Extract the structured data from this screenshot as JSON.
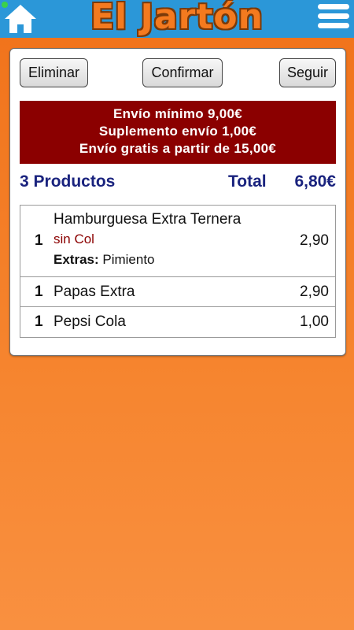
{
  "header": {
    "title": "El Jartón",
    "home_icon": "home-icon",
    "menu_icon": "hamburger-menu-icon",
    "bar_color": "#2b97d8"
  },
  "actions": {
    "delete_label": "Eliminar",
    "confirm_label": "Confirmar",
    "continue_label": "Seguir"
  },
  "delivery_info": {
    "line1": "Envío mínimo 9,00€",
    "line2": "Suplemento envío 1,00€",
    "line3": "Envío gratis a partir de 15,00€",
    "color": "#8b0000"
  },
  "summary": {
    "count_label": "3 Productos",
    "total_label": "Total",
    "total_value": "6,80€"
  },
  "items": [
    {
      "qty": "1",
      "name": "Hamburguesa Extra Ternera",
      "note": "sin Col",
      "extras_label": "Extras:",
      "extras_value": "Pimiento",
      "price": "2,90"
    },
    {
      "qty": "1",
      "name": "Papas Extra",
      "price": "2,90"
    },
    {
      "qty": "1",
      "name": "Pepsi Cola",
      "price": "1,00"
    }
  ]
}
